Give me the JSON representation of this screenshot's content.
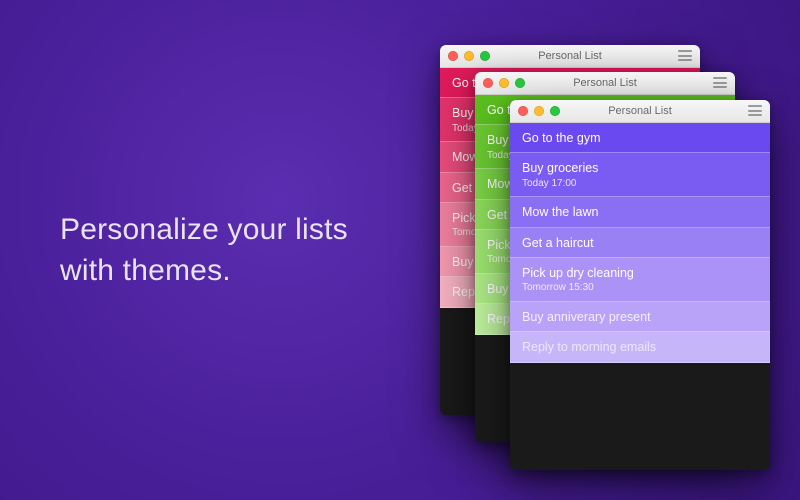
{
  "tagline_line1": "Personalize your lists",
  "tagline_line2": "with themes.",
  "window_title": "Personal List",
  "tasks": [
    {
      "title": "Go to the gym"
    },
    {
      "title": "Buy groceries",
      "sub": "Today 17:00"
    },
    {
      "title": "Mow the lawn"
    },
    {
      "title": "Get a haircut"
    },
    {
      "title": "Pick up dry cleaning",
      "sub": "Tomorrow 15:30"
    },
    {
      "title": "Buy anniverary present"
    },
    {
      "title": "Reply to morning emails"
    }
  ],
  "themes": {
    "back": "pink",
    "mid": "green",
    "front": "purple"
  }
}
